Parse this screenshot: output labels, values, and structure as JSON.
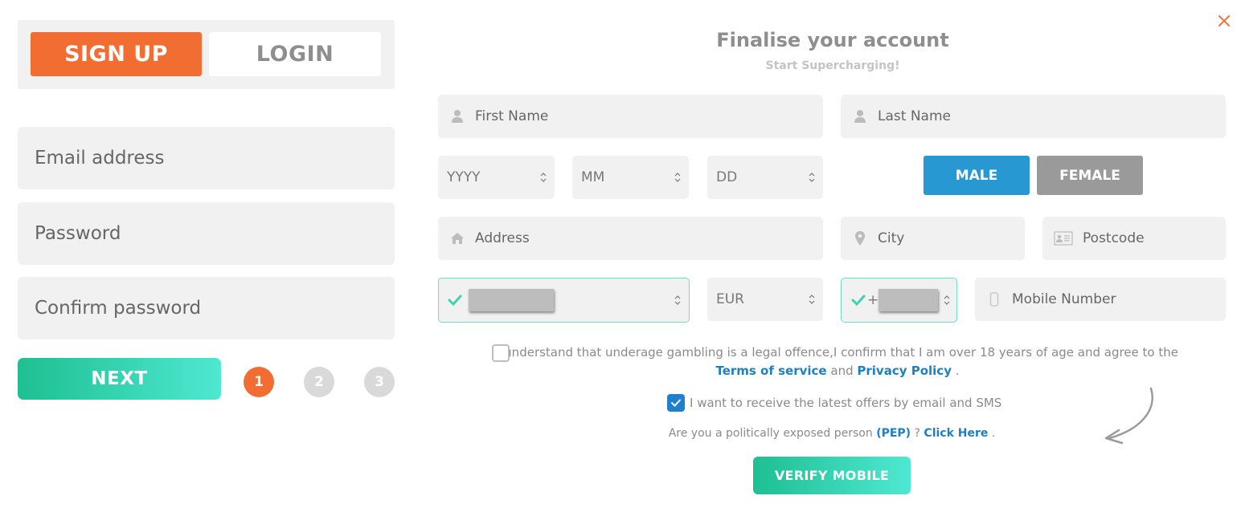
{
  "auth_tabs": {
    "signup": "SIGN UP",
    "login": "LOGIN",
    "active": "signup"
  },
  "step1": {
    "email_placeholder": "Email address",
    "password_placeholder": "Password",
    "confirm_password_placeholder": "Confirm password",
    "next_label": "NEXT",
    "steps": [
      "1",
      "2",
      "3"
    ],
    "current_step": 1
  },
  "form": {
    "title": "Finalise your account",
    "subtitle": "Start Supercharging!",
    "first_name_placeholder": "First Name",
    "last_name_placeholder": "Last Name",
    "year_placeholder": "YYYY",
    "month_placeholder": "MM",
    "day_placeholder": "DD",
    "gender": {
      "male": "MALE",
      "female": "FEMALE",
      "selected": "male"
    },
    "address_placeholder": "Address",
    "city_placeholder": "City",
    "postcode_placeholder": "Postcode",
    "country_value": "[redacted]",
    "currency_value": "EUR",
    "phone_prefix": "+",
    "phone_code_value": "[redacted]",
    "mobile_placeholder": "Mobile Number"
  },
  "consent": {
    "age_text_1": "I understand that underage gambling is a legal offence,I confirm that I am over 18 years of age and agree to the",
    "terms_link": "Terms of service",
    "and": "and",
    "privacy_link": "Privacy Policy",
    "period": ".",
    "age_checked": false,
    "offers_text": "I want to receive the latest offers by email and SMS",
    "offers_checked": true,
    "pep_text": "Are you a politically exposed person",
    "pep_link": "(PEP)",
    "pep_q": "?",
    "click_here": "Click Here",
    "pep_period": "."
  },
  "verify_label": "VERIFY MOBILE",
  "colors": {
    "orange": "#f26d32",
    "blue": "#2798d1",
    "teal_start": "#1ebf91",
    "teal_end": "#4ee8d2",
    "link": "#1e7fc2"
  }
}
